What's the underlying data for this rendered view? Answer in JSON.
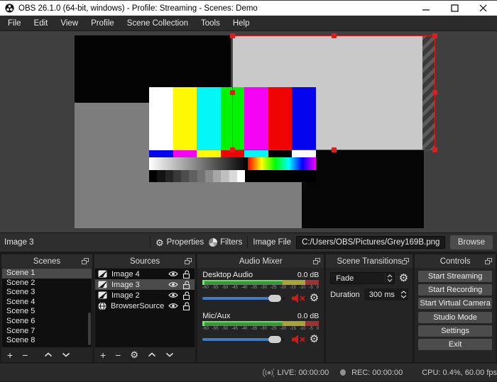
{
  "window": {
    "title": "OBS 26.1.0 (64-bit, windows) - Profile: Streaming - Scenes: Demo"
  },
  "menu": {
    "items": [
      "File",
      "Edit",
      "View",
      "Profile",
      "Scene Collection",
      "Tools",
      "Help"
    ]
  },
  "preview": {
    "bars": [
      "#ffffff",
      "#fdf803",
      "#03f7f7",
      "#04f304",
      "#f503f5",
      "#ef0303",
      "#0404ef"
    ],
    "small_bars": [
      "#0404ef",
      "#f503f5",
      "#fdf803",
      "#ef0303",
      "#03f7f7",
      "#000000",
      "#ffffff"
    ],
    "gray_steps": [
      "#000000",
      "#131313",
      "#262626",
      "#393939",
      "#4d4d4d",
      "#606060",
      "#737373",
      "#8c8c8c",
      "#a6a6a6",
      "#bfbfbf",
      "#d9d9d9",
      "#ffffff"
    ]
  },
  "source_toolbar": {
    "selected_source": "Image 3",
    "properties_label": "Properties",
    "filters_label": "Filters",
    "image_file_label": "Image File",
    "image_file_path": "C:/Users/OBS/Pictures/Grey169B.png",
    "browse_label": "Browse"
  },
  "scenes": {
    "title": "Scenes",
    "selected": "Scene 1",
    "items": [
      "Scene 1",
      "Scene 2",
      "Scene 3",
      "Scene 4",
      "Scene 5",
      "Scene 6",
      "Scene 7",
      "Scene 8"
    ]
  },
  "sources": {
    "title": "Sources",
    "items": [
      {
        "name": "Image 4",
        "type": "image",
        "selected": false
      },
      {
        "name": "Image 3",
        "type": "image",
        "selected": true
      },
      {
        "name": "Image 2",
        "type": "image",
        "selected": false
      },
      {
        "name": "BrowserSource",
        "type": "browser",
        "selected": false
      }
    ]
  },
  "mixer": {
    "title": "Audio Mixer",
    "scale_ticks": [
      "-60",
      "-55",
      "-50",
      "-45",
      "-40",
      "-35",
      "-30",
      "-25",
      "-20",
      "-15",
      "-10",
      "-5",
      "0"
    ],
    "channels": [
      {
        "name": "Desktop Audio",
        "level_db": "0.0 dB"
      },
      {
        "name": "Mic/Aux",
        "level_db": "0.0 dB"
      }
    ]
  },
  "transitions": {
    "title": "Scene Transitions",
    "transition": "Fade",
    "duration_label": "Duration",
    "duration_value": "300 ms"
  },
  "controls": {
    "title": "Controls",
    "buttons": [
      "Start Streaming",
      "Start Recording",
      "Start Virtual Camera",
      "Studio Mode",
      "Settings",
      "Exit"
    ]
  },
  "status_bar": {
    "live_label": "LIVE: 00:00:00",
    "rec_label": "REC: 00:00:00",
    "cpu_label": "CPU: 0.4%, 60.00 fps"
  }
}
